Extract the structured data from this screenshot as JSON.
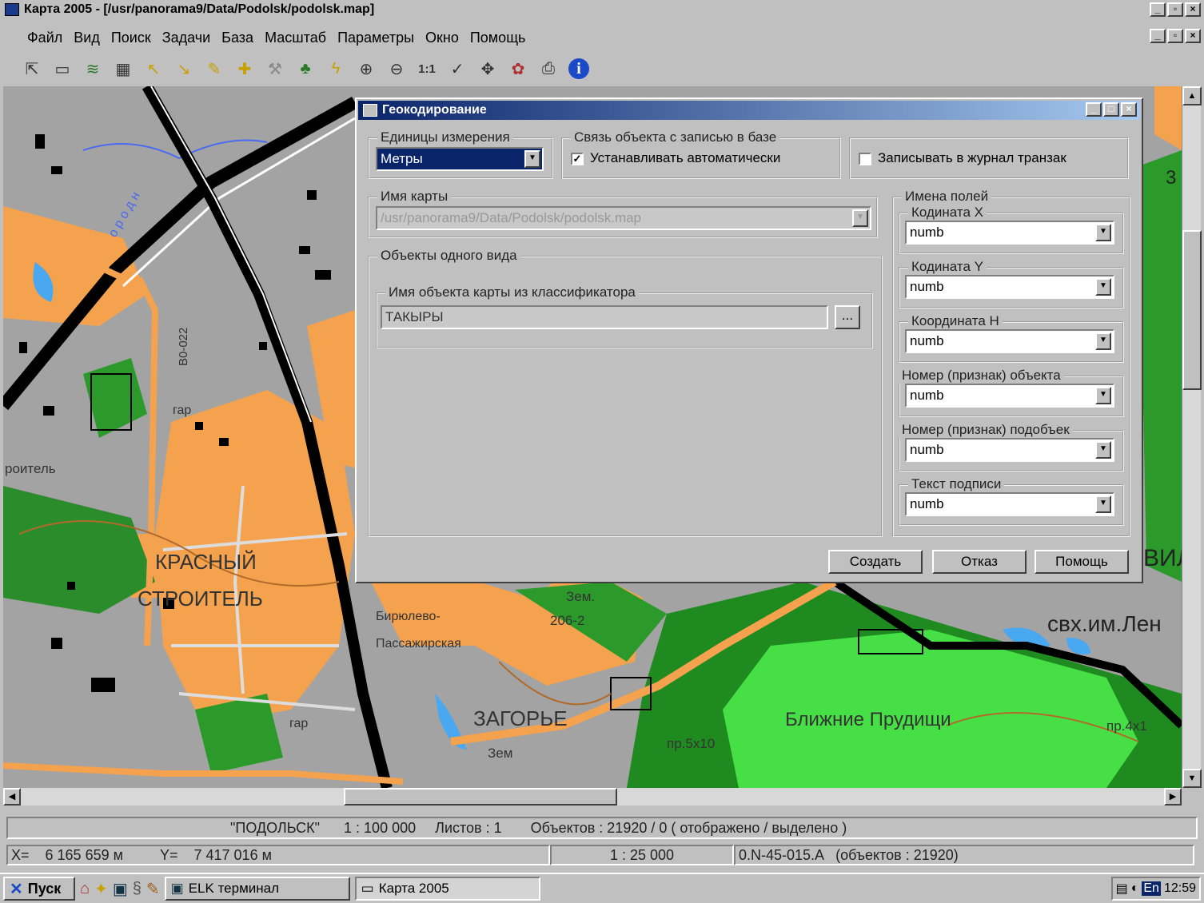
{
  "window": {
    "title": "Карта 2005  -  [/usr/panorama9/Data/Podolsk/podolsk.map]"
  },
  "menu": [
    "Файл",
    "Вид",
    "Поиск",
    "Задачи",
    "База",
    "Масштаб",
    "Параметры",
    "Окно",
    "Помощь"
  ],
  "toolbar_icons": [
    "open-icon",
    "new-icon",
    "layers-icon",
    "table-icon",
    "select-icon",
    "select-area-icon",
    "select-edit-icon",
    "select-add-icon",
    "tool-icon",
    "tree-icon",
    "lightning-icon",
    "zoom-in-icon",
    "zoom-out-icon",
    "scale-1to1-icon",
    "check-icon",
    "move-icon",
    "palette-icon",
    "print-icon",
    "info-icon"
  ],
  "map_labels": {
    "krasny": "КРАСНЫЙ",
    "stroitel": "СТРОИТЕЛЬ",
    "zagorye": "ЗАГОРЬЕ",
    "prudishchi": "Ближние Прудищи",
    "svkh": "свх.им.Лен",
    "birulevo": "Бирюлево-",
    "passazh": "Пассажирская",
    "zem1": "Зем.",
    "zem2": "Зем",
    "num": "206-2",
    "gar1": "гар",
    "gar2": "гар",
    "pr1": "пр.5х10",
    "pr2": "пр.4х1",
    "stroitel2": "роитель",
    "road": "В0-022",
    "gorod": "о р о д н",
    "n35": "3",
    "vil": "ВИЛ"
  },
  "dialog": {
    "title": "Геокодирование",
    "units_label": "Единицы измерения",
    "units_value": "Метры",
    "link_label": "Связь объекта с записью в базе",
    "auto_label": "Устанавливать автоматически",
    "auto_checked": true,
    "journal_label": "Записывать в журнал транзак",
    "journal_checked": false,
    "mapname_label": "Имя карты",
    "mapname_value": "/usr/panorama9/Data/Podolsk/podolsk.map",
    "objects_label": "Объекты одного вида",
    "classname_label": "Имя объекта карты из классификатора",
    "classname_value": "ТАКЫРЫ",
    "browse_label": "...",
    "fields_label": "Имена полей",
    "fields": [
      {
        "label": "Кодината  X",
        "value": "numb"
      },
      {
        "label": "Кодината  Y",
        "value": "numb"
      },
      {
        "label": "Координата  H",
        "value": "numb"
      },
      {
        "label": "Номер (признак) объекта",
        "value": "numb"
      },
      {
        "label": "Номер (признак) подобъек",
        "value": "numb"
      },
      {
        "label": "Текст подписи",
        "value": "numb"
      }
    ],
    "create_label": "Создать",
    "cancel_label": "Отказ",
    "help_label": "Помощь"
  },
  "status1": {
    "name": "\"ПОДОЛЬСК\"",
    "scale": "1 : 100 000",
    "sheets": "Листов : 1",
    "objects": "Объектов : 21920 / 0 ( отображено / выделено )"
  },
  "status2": {
    "x": "X=    6 165 659 м",
    "y": "Y=    7 417 016 м",
    "scale": "1 : 25 000",
    "sheet": "0.N-45-015.A   (объектов : 21920)"
  },
  "taskbar": {
    "start": "Пуск",
    "items": [
      "ELK терминал",
      "Карта 2005"
    ],
    "lang": "En",
    "time": "12:59"
  }
}
